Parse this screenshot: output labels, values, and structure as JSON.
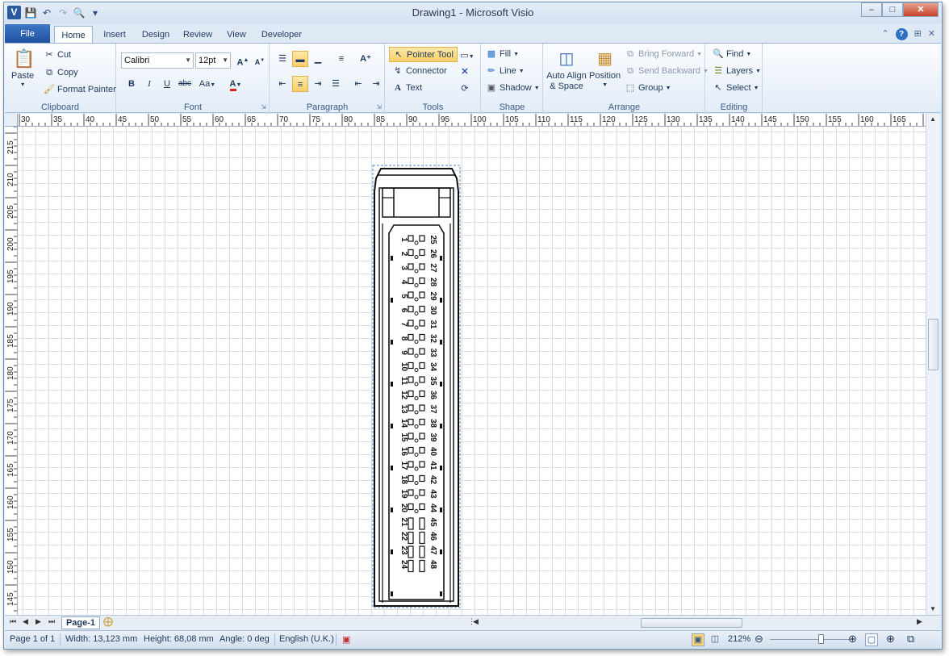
{
  "window": {
    "title": "Drawing1 - Microsoft Visio"
  },
  "tabs": {
    "file": "File",
    "home": "Home",
    "insert": "Insert",
    "design": "Design",
    "review": "Review",
    "view": "View",
    "developer": "Developer"
  },
  "clipboard": {
    "paste": "Paste",
    "cut": "Cut",
    "copy": "Copy",
    "format_painter": "Format Painter",
    "label": "Clipboard"
  },
  "font": {
    "family": "Calibri",
    "size": "12pt",
    "label": "Font",
    "bold": "B",
    "italic": "I",
    "underline": "U",
    "strike": "abc",
    "case": "Aa",
    "color": "A",
    "grow": "A",
    "shrink": "A"
  },
  "paragraph": {
    "label": "Paragraph"
  },
  "tools": {
    "pointer": "Pointer Tool",
    "connector": "Connector",
    "text": "Text",
    "label": "Tools"
  },
  "shape": {
    "fill": "Fill",
    "line": "Line",
    "shadow": "Shadow",
    "label": "Shape"
  },
  "arrange": {
    "auto_align": "Auto Align & Space",
    "position": "Position",
    "bring_forward": "Bring Forward",
    "send_backward": "Send Backward",
    "group": "Group",
    "label": "Arrange"
  },
  "editing": {
    "find": "Find",
    "layers": "Layers",
    "select": "Select",
    "label": "Editing"
  },
  "ruler": {
    "h_ticks": [
      "30",
      "35",
      "40",
      "45",
      "50",
      "55",
      "60",
      "65",
      "70",
      "75",
      "80",
      "85",
      "90",
      "95",
      "100",
      "105",
      "110",
      "115",
      "120",
      "125",
      "130",
      "135",
      "140",
      "145",
      "150",
      "155",
      "160",
      "165"
    ],
    "v_ticks": [
      "215",
      "210",
      "205",
      "200",
      "195",
      "190",
      "185",
      "180",
      "175",
      "170",
      "165",
      "160",
      "155",
      "150",
      "145"
    ]
  },
  "drawing": {
    "pins_left": [
      "1",
      "2",
      "3",
      "4",
      "5",
      "6",
      "7",
      "8",
      "9",
      "10",
      "11",
      "12",
      "13",
      "14",
      "15",
      "16",
      "17",
      "18",
      "19",
      "20",
      "21",
      "22",
      "23",
      "24"
    ],
    "pins_right": [
      "25",
      "26",
      "27",
      "28",
      "29",
      "30",
      "31",
      "32",
      "33",
      "34",
      "35",
      "36",
      "37",
      "38",
      "39",
      "40",
      "41",
      "42",
      "43",
      "44",
      "45",
      "46",
      "47",
      "48"
    ]
  },
  "pagebar": {
    "page": "Page-1"
  },
  "status": {
    "page": "Page 1 of 1",
    "width": "Width: 13,123 mm",
    "height": "Height: 68,08 mm",
    "angle": "Angle: 0 deg",
    "language": "English (U.K.)",
    "zoom": "212%"
  }
}
